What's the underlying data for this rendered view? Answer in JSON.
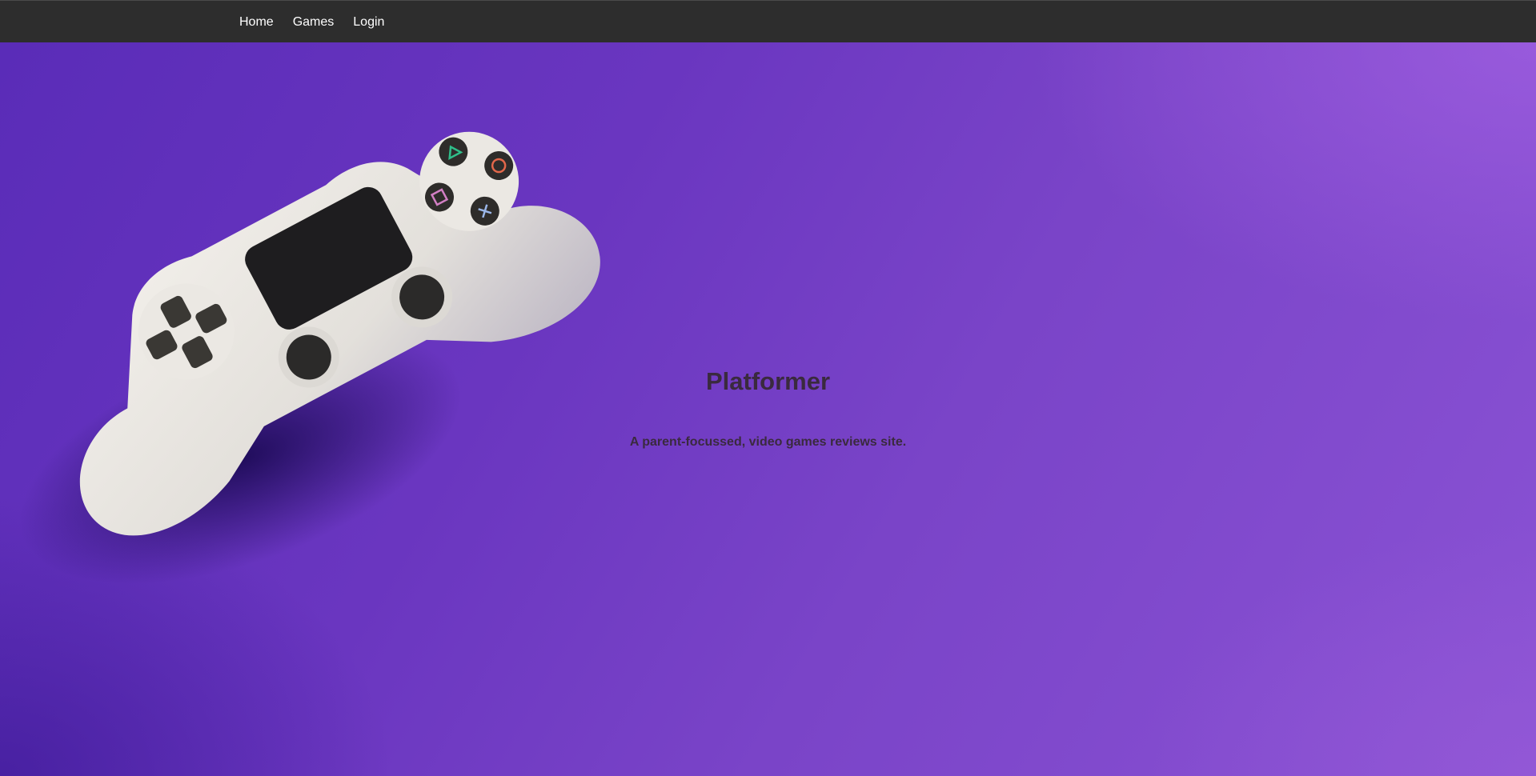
{
  "nav": {
    "items": [
      {
        "label": "Home"
      },
      {
        "label": "Games"
      },
      {
        "label": "Login"
      }
    ]
  },
  "hero": {
    "title": "Platformer",
    "subtitle": "A parent-focussed, video games reviews site.",
    "image": "gamepad-controller-photo"
  },
  "colors": {
    "navbar": "#2d2d2d",
    "hero_background": "#6a36c0",
    "heading_text": "#3a2a3e",
    "nav_text": "#ffffff"
  }
}
